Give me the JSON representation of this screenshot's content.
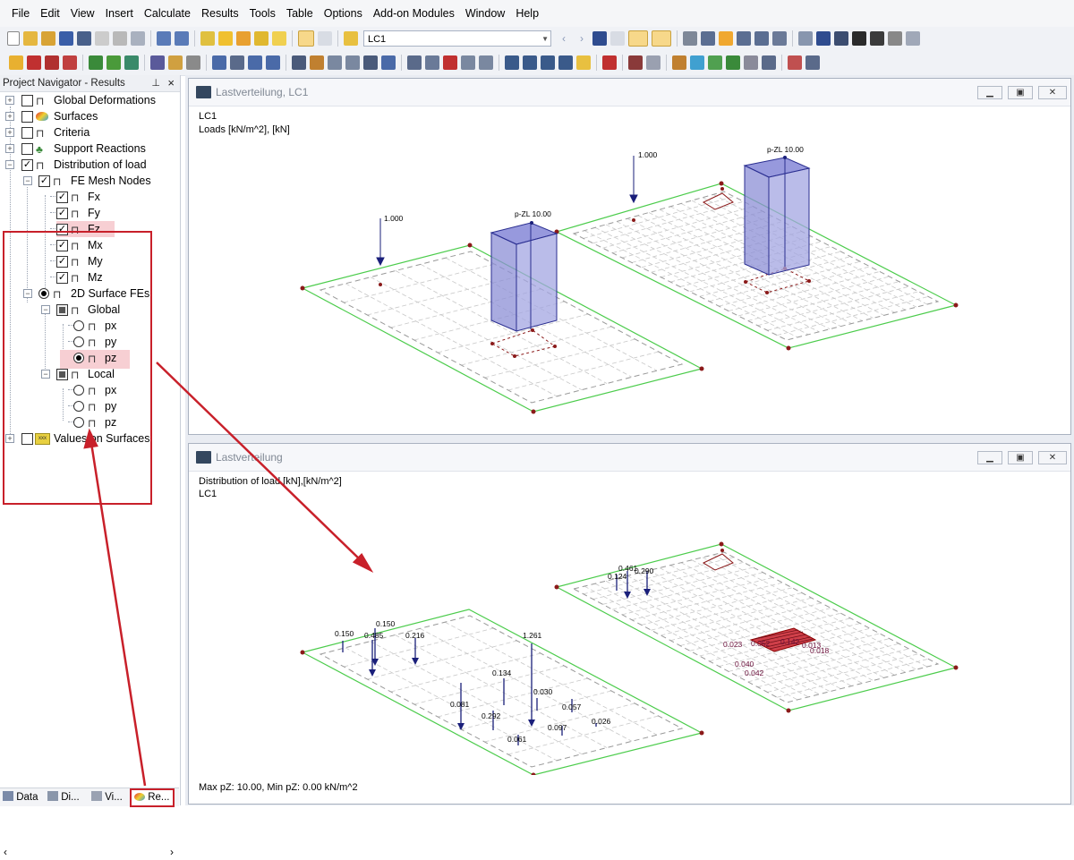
{
  "menu": [
    "File",
    "Edit",
    "View",
    "Insert",
    "Calculate",
    "Results",
    "Tools",
    "Table",
    "Options",
    "Add-on Modules",
    "Window",
    "Help"
  ],
  "toolbar": {
    "loadcase": "LC1"
  },
  "navigator": {
    "title": "Project Navigator - Results",
    "items": {
      "global_deformations": "Global Deformations",
      "surfaces": "Surfaces",
      "criteria": "Criteria",
      "support_reactions": "Support Reactions",
      "distribution_of_load": "Distribution of load",
      "fe_mesh_nodes": "FE Mesh Nodes",
      "fx": "Fx",
      "fy": "Fy",
      "fz": "Fz",
      "mx": "Mx",
      "my": "My",
      "mz": "Mz",
      "surface_fes": "2D Surface FEs",
      "global": "Global",
      "g_px": "px",
      "g_py": "py",
      "g_pz": "pz",
      "local": "Local",
      "l_px": "px",
      "l_py": "py",
      "l_pz": "pz",
      "values_on_surfaces": "Values on Surfaces"
    },
    "tabs": [
      "Data",
      "Di...",
      "Vi...",
      "Re..."
    ]
  },
  "window1": {
    "title": "Lastverteilung, LC1",
    "line1": "LC1",
    "line2": "Loads [kN/m^2], [kN]",
    "labels": {
      "load_left": "1.000",
      "load_right": "1.000",
      "pzl_left": "p-ZL 10.00",
      "pzl_right": "p-ZL 10.00"
    }
  },
  "window2": {
    "title": "Lastverteilung",
    "line1": "Distribution of load [kN],[kN/m^2]",
    "line2": "LC1",
    "footer": "Max pZ: 10.00, Min pZ: 0.00 kN/m^2",
    "values_left": [
      "0.150",
      "0.150",
      "0.485",
      "0.216",
      "1.261",
      "0.134",
      "0.030",
      "0.081",
      "0.292",
      "0.057",
      "0.097",
      "0.026",
      "0.061"
    ],
    "values_right": [
      "0.461",
      "0.124",
      "0.290",
      "0.023",
      "0.052",
      "0.142",
      "0.013",
      "0.018",
      "0.040",
      "0.042"
    ]
  },
  "colors": {
    "accent_red": "#c8202a",
    "load_blue": "#1a1f7a",
    "plate_green": "#4ccc4c",
    "block_fill": "#8c8fd6"
  }
}
